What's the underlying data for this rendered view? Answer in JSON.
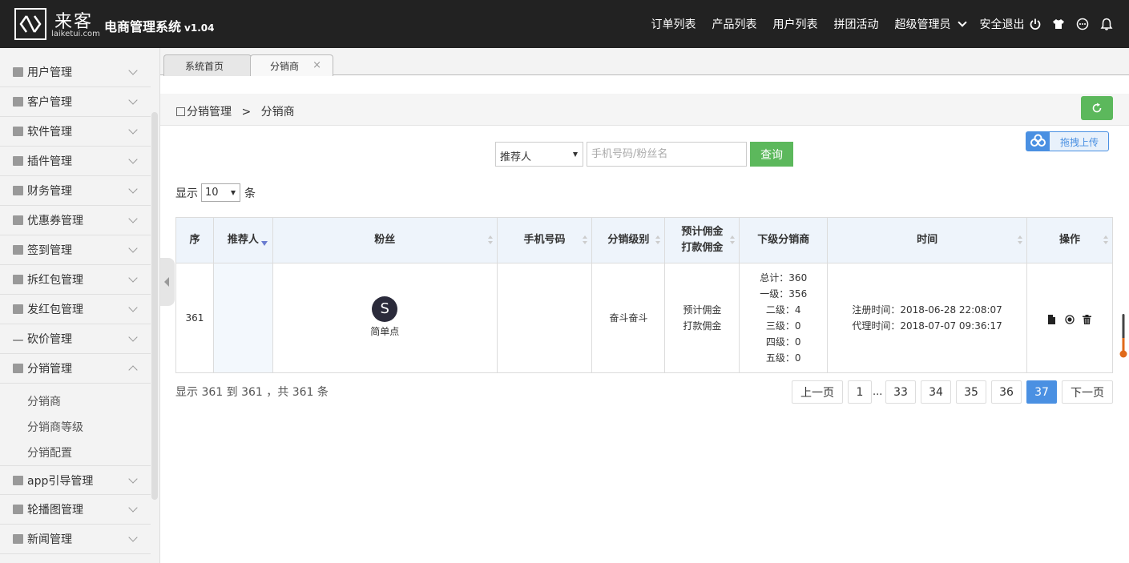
{
  "header": {
    "logo_cn": "来客",
    "logo_en": "laiketui.com",
    "system_title": "电商管理系统",
    "version": "v1.04",
    "nav": [
      "订单列表",
      "产品列表",
      "用户列表",
      "拼团活动"
    ],
    "admin_label": "超级管理员",
    "logout_label": "安全退出"
  },
  "sidebar": {
    "items": [
      {
        "label": "用户管理",
        "icon": "user-icon"
      },
      {
        "label": "客户管理",
        "icon": "customer-icon"
      },
      {
        "label": "软件管理",
        "icon": "grid-icon"
      },
      {
        "label": "插件管理",
        "icon": "puzzle-icon"
      },
      {
        "label": "财务管理",
        "icon": "bank-icon"
      },
      {
        "label": "优惠券管理",
        "icon": "coupon-icon"
      },
      {
        "label": "签到管理",
        "icon": "clipboard-icon"
      },
      {
        "label": "拆红包管理",
        "icon": "redpacket-icon"
      },
      {
        "label": "发红包管理",
        "icon": "redpacket-icon"
      },
      {
        "label": "砍价管理",
        "icon": "chart-icon"
      },
      {
        "label": "分销管理",
        "icon": "book-icon"
      }
    ],
    "sub_items": [
      "分销商",
      "分销商等级",
      "分销配置"
    ],
    "items_after": [
      {
        "label": "app引导管理",
        "icon": "image-icon"
      },
      {
        "label": "轮播图管理",
        "icon": "image-icon"
      },
      {
        "label": "新闻管理",
        "icon": "news-icon"
      }
    ]
  },
  "tabs": [
    {
      "label": "系统首页"
    },
    {
      "label": "分销商",
      "close": "×"
    }
  ],
  "breadcrumb": {
    "parent": "分销管理",
    "separator": ">",
    "current": "分销商"
  },
  "upload": {
    "label": "拖拽上传"
  },
  "search": {
    "select_value": "推荐人",
    "placeholder": "手机号码/粉丝名",
    "button": "查询"
  },
  "page_size": {
    "prefix": "显示",
    "value": "10",
    "suffix": "条"
  },
  "table": {
    "headers": [
      "序",
      "推荐人",
      "粉丝",
      "手机号码",
      "分销级别",
      "预计佣金",
      "打款佣金",
      "下级分销商",
      "时间",
      "操作"
    ],
    "row": {
      "seq": "361",
      "referrer": "",
      "avatar_letter": "S",
      "fan_name": "简单点",
      "phone": "",
      "level": "奋斗奋斗",
      "expected_commission": "预计佣金",
      "paid_commission": "打款佣金",
      "sub_total": "总计：360",
      "sub_l1": "一级：356",
      "sub_l2": "二级：4",
      "sub_l3": "三级：0",
      "sub_l4": "四级：0",
      "sub_l5": "五级：0",
      "register_time": "注册时间：2018-06-28 22:08:07",
      "agent_time": "代理时间：2018-07-07 09:36:17"
    }
  },
  "footer": {
    "info": "显示 361 到 361 ，共 361 条",
    "prev": "上一页",
    "next": "下一页",
    "pages": [
      "1",
      "33",
      "34",
      "35",
      "36",
      "37"
    ],
    "ellipsis": "...",
    "active_page": "37"
  },
  "colors": {
    "topbar": "#222222",
    "green": "#5cb85c",
    "blue": "#4a90e2"
  }
}
